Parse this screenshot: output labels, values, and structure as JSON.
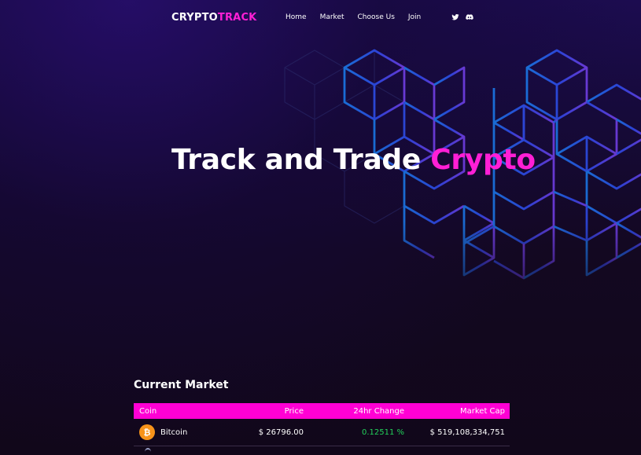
{
  "brand": {
    "part1": "CRYPTO",
    "part2": "TRACK",
    "accent_color": "#ff1fd6"
  },
  "nav": {
    "links": [
      {
        "label": "Home"
      },
      {
        "label": "Market"
      },
      {
        "label": "Choose Us"
      },
      {
        "label": "Join"
      }
    ],
    "socials": [
      {
        "icon": "twitter-icon"
      },
      {
        "icon": "discord-icon"
      }
    ]
  },
  "hero": {
    "title_main": "Track and Trade ",
    "title_accent": "Crypto"
  },
  "market": {
    "title": "Current Market",
    "columns": {
      "coin": "Coin",
      "price": "Price",
      "change": "24hr Change",
      "cap": "Market Cap"
    },
    "header_color": "#ff00d4",
    "rows": [
      {
        "icon": "bitcoin-icon",
        "icon_symbol": "₿",
        "icon_color": "#f7931a",
        "name": "Bitcoin",
        "price": "$ 26796.00",
        "change": "0.12511 %",
        "change_color": "#22d15a",
        "cap": "$ 519,108,334,751"
      }
    ]
  }
}
